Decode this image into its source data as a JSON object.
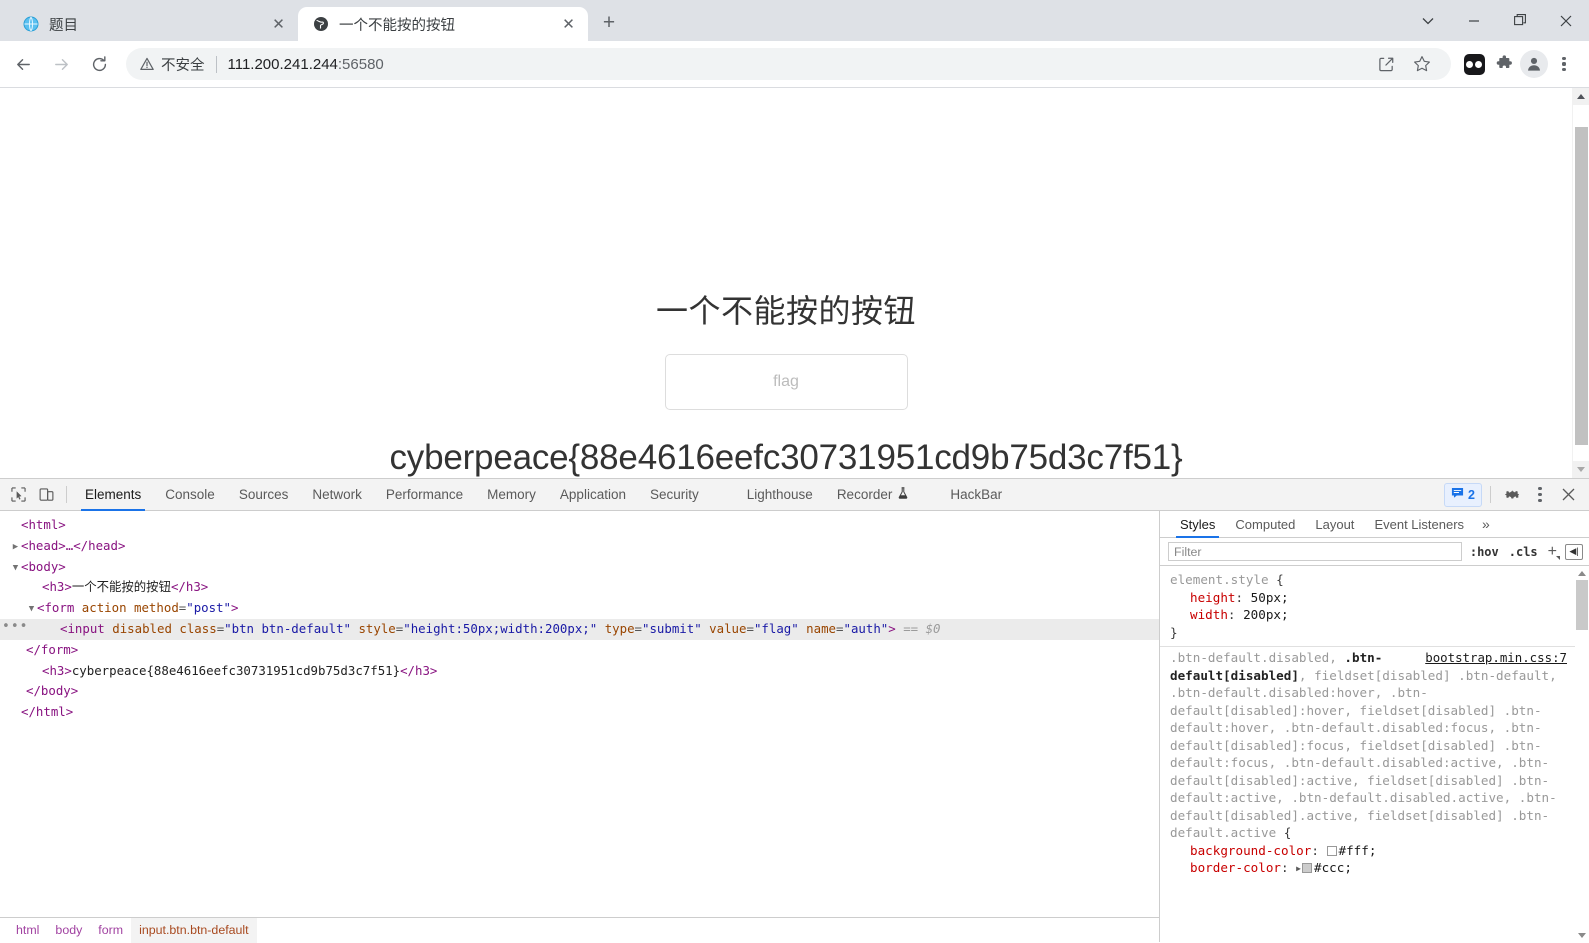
{
  "browser": {
    "tabs": [
      {
        "title": "题目",
        "favicon": "globe-blue-icon",
        "active": false
      },
      {
        "title": "一个不能按的按钮",
        "favicon": "globe-dark-icon",
        "active": true
      }
    ],
    "new_tab_label": "+",
    "window_controls": {
      "tab_search": "tab-search-icon",
      "minimize": "minimize-icon",
      "maximize": "maximize-icon",
      "close": "close-icon"
    },
    "toolbar": {
      "back": "back-arrow-icon",
      "forward": "forward-arrow-icon",
      "reload": "reload-icon",
      "security_label": "不安全",
      "url_host": "111.200.241.244",
      "url_port": ":56580",
      "share": "share-icon",
      "bookmark": "star-icon",
      "extension_dark": "dark-reader-extension-icon",
      "extensions": "puzzle-piece-icon",
      "profile": "profile-avatar-icon",
      "menu": "kebab-menu-icon"
    }
  },
  "page": {
    "heading": "一个不能按的按钮",
    "button_value": "flag",
    "flag": "cyberpeace{88e4616eefc30731951cd9b75d3c7f51}"
  },
  "devtools": {
    "inspect_icon": "inspect-element-icon",
    "device_icon": "device-toolbar-icon",
    "tabs": [
      {
        "label": "Elements",
        "selected": true
      },
      {
        "label": "Console",
        "selected": false
      },
      {
        "label": "Sources",
        "selected": false
      },
      {
        "label": "Network",
        "selected": false
      },
      {
        "label": "Performance",
        "selected": false
      },
      {
        "label": "Memory",
        "selected": false
      },
      {
        "label": "Application",
        "selected": false
      },
      {
        "label": "Security",
        "selected": false
      },
      {
        "label": "Lighthouse",
        "selected": false
      },
      {
        "label": "Recorder",
        "selected": false,
        "badge_icon": "flask-icon"
      },
      {
        "label": "HackBar",
        "selected": false
      }
    ],
    "message_count": "2",
    "message_icon": "message-bubble-icon",
    "settings_icon": "gear-icon",
    "more_icon": "kebab-menu-icon",
    "close_icon": "close-icon",
    "dom": {
      "l_html_open": "<html>",
      "l_head": "<head>…</head>",
      "l_body_open": "<body>",
      "h3_open": "<h3>",
      "h3_text": "一个不能按的按钮",
      "h3_close": "</h3>",
      "form_open_tag": "<form",
      "form_attr_action": "action",
      "form_attr_method": "method",
      "form_method_value": "\"post\"",
      "form_close_bracket": ">",
      "input_tag": "<input",
      "input_disabled": "disabled",
      "input_attr_class": "class",
      "input_class_value": "\"btn btn-default\"",
      "input_attr_style": "style",
      "input_style_value": "\"height:50px;width:200px;\"",
      "input_attr_type": "type",
      "input_type_value": "\"submit\"",
      "input_attr_value": "value",
      "input_value_value": "\"flag\"",
      "input_attr_name": "name",
      "input_name_value": "\"auth\"",
      "input_close_bracket": ">",
      "input_selected_marker": "== $0",
      "l_form_close": "</form>",
      "h3b_open": "<h3>",
      "h3b_text": "cyberpeace{88e4616eefc30731951cd9b75d3c7f51}",
      "h3b_close": "</h3>",
      "l_body_close": "</body>",
      "l_html_close": "</html>"
    },
    "breadcrumb": [
      {
        "label": "html",
        "selected": false
      },
      {
        "label": "body",
        "selected": false
      },
      {
        "label": "form",
        "selected": false
      },
      {
        "label": "input.btn.btn-default",
        "selected": true
      }
    ],
    "styles": {
      "tabs": [
        {
          "label": "Styles",
          "selected": true
        },
        {
          "label": "Computed",
          "selected": false
        },
        {
          "label": "Layout",
          "selected": false
        },
        {
          "label": "Event Listeners",
          "selected": false
        }
      ],
      "more_label": "»",
      "filter_placeholder": "Filter",
      "hov_label": ":hov",
      "cls_label": ".cls",
      "add_rule_label": "+",
      "sidebar_toggle_icon": "toggle-sidebar-icon",
      "rules": [
        {
          "selector": "element.style",
          "selector_matched": "",
          "source": "",
          "open_brace": "{",
          "close_brace": "}",
          "declarations": [
            {
              "name": "height",
              "value": "50px;",
              "swatch": ""
            },
            {
              "name": "width",
              "value": "200px;",
              "swatch": ""
            }
          ]
        },
        {
          "selector_head": ".btn-default.disabled,",
          "selector_matched": ".btn-default[disabled]",
          "selector_rest": ", fieldset[disabled] .btn-default, .btn-default.disabled:hover, .btn-default[disabled]:hover, fieldset[disabled] .btn-default:hover, .btn-default.disabled:focus, .btn-default[disabled]:focus, fieldset[disabled] .btn-default:focus, .btn-default.disabled:active, .btn-default[disabled]:active, fieldset[disabled] .btn-default:active, .btn-default.disabled.active, .btn-default[disabled].active, fieldset[disabled] .btn-default.active",
          "source": "bootstrap.min.css:7",
          "open_brace": "{",
          "declarations": [
            {
              "name": "background-color",
              "value": "#fff;",
              "swatch": "#ffffff"
            },
            {
              "name": "border-color",
              "value": "#ccc;",
              "swatch": "#cccccc"
            }
          ]
        }
      ]
    }
  },
  "colors": {
    "accent": "#1a73e8",
    "chrome_tabstrip": "#dee1e6",
    "devtools_bg": "#f3f3f3",
    "tag_purple": "#881280",
    "attr_orange": "#994500",
    "attr_blue": "#1a1aa6",
    "css_name_red": "#c80000"
  }
}
